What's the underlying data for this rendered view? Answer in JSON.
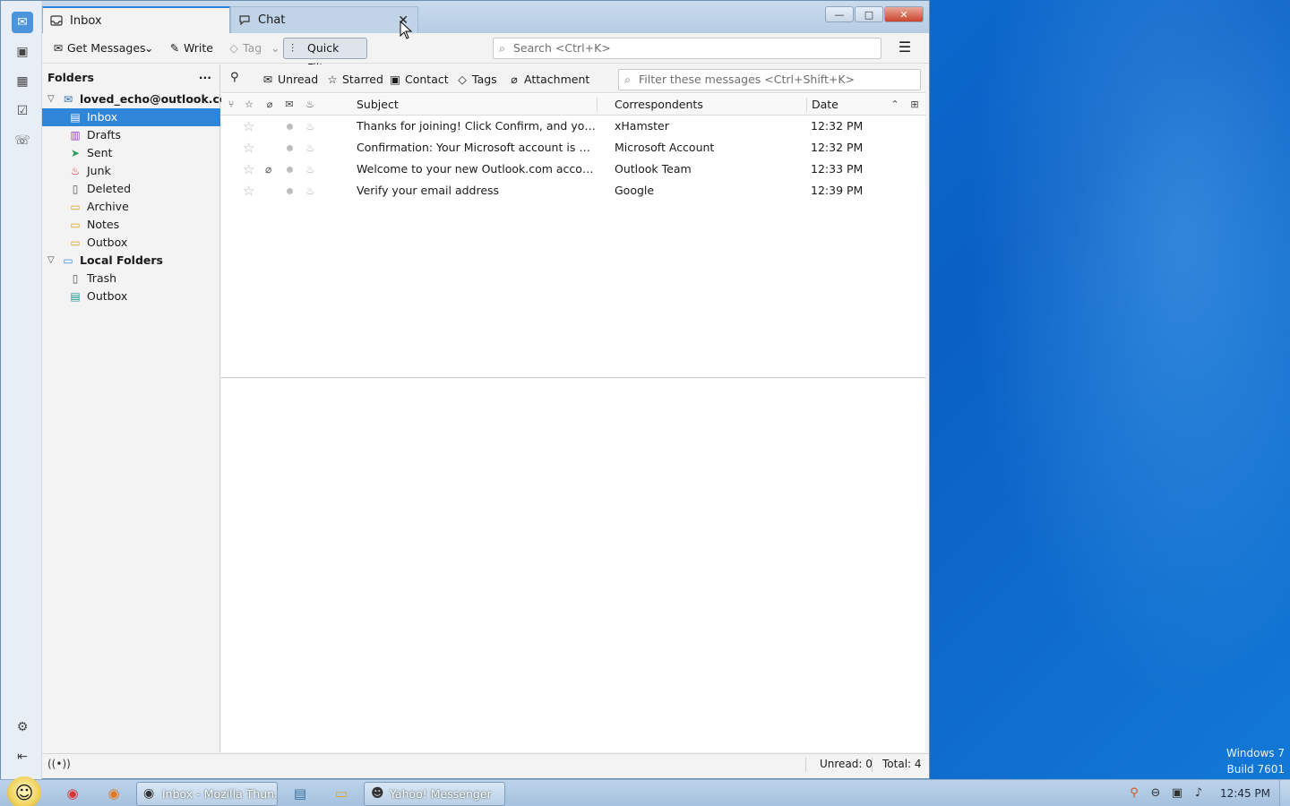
{
  "window": {
    "tabs": [
      {
        "label": "Inbox",
        "icon": "inbox-icon"
      },
      {
        "label": "Chat",
        "icon": "chat-icon"
      }
    ],
    "controls": {
      "minimize": "—",
      "maximize": "□",
      "close": "✕"
    }
  },
  "toolbar": {
    "get_messages": "Get Messages",
    "write": "Write",
    "tag": "Tag",
    "quick_filter": "Quick Filter",
    "search_placeholder": "Search <Ctrl+K>"
  },
  "folders": {
    "header": "Folders",
    "more": "···",
    "accounts": [
      {
        "name": "loved_echo@outlook.com",
        "items": [
          "Inbox",
          "Drafts",
          "Sent",
          "Junk",
          "Deleted",
          "Archive",
          "Notes",
          "Outbox"
        ]
      },
      {
        "name": "Local Folders",
        "items": [
          "Trash",
          "Outbox"
        ]
      }
    ],
    "selected": "Inbox"
  },
  "quick_filter_bar": {
    "unread": "Unread",
    "starred": "Starred",
    "contact": "Contact",
    "tags": "Tags",
    "attachment": "Attachment",
    "filter_placeholder": "Filter these messages <Ctrl+Shift+K>"
  },
  "columns": {
    "subject": "Subject",
    "correspondents": "Correspondents",
    "date": "Date"
  },
  "messages": [
    {
      "subject": "Thanks for joining! Click Confirm, and you are re...",
      "from": "xHamster",
      "date": "12:32 PM",
      "attachment": false
    },
    {
      "subject": "Confirmation: Your Microsoft account is waiting",
      "from": "Microsoft Account",
      "date": "12:32 PM",
      "attachment": false
    },
    {
      "subject": "Welcome to your new Outlook.com account",
      "from": "Outlook Team",
      "date": "12:33 PM",
      "attachment": true
    },
    {
      "subject": "Verify your email address",
      "from": "Google",
      "date": "12:39 PM",
      "attachment": false
    }
  ],
  "status": {
    "unread": "Unread: 0",
    "total": "Total: 4"
  },
  "taskbar": {
    "tasks": [
      {
        "label": "Inbox - Mozilla Thun...",
        "icon": "thunderbird-icon"
      },
      {
        "label": "Yahoo! Messenger",
        "icon": "yahoo-messenger-icon"
      }
    ],
    "clock": "12:45 PM"
  },
  "desktop": {
    "os_name": "Windows 7",
    "build": "Build 7601"
  },
  "colors": {
    "accent": "#2f86d9",
    "desktop": "#0d6fd2"
  }
}
